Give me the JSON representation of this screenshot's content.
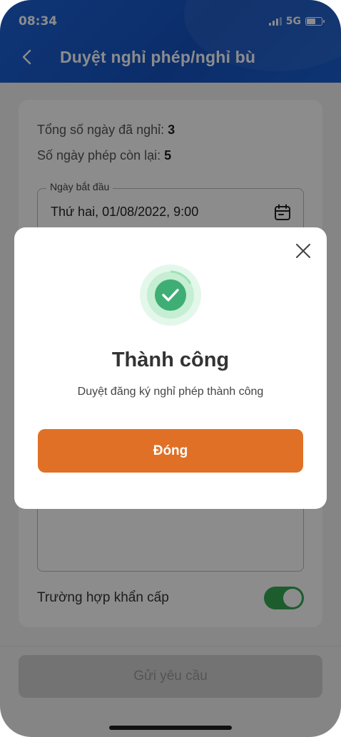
{
  "status_bar": {
    "time": "08:34",
    "network": "5G"
  },
  "header": {
    "title": "Duyệt nghỉ phép/nghỉ bù"
  },
  "form": {
    "total_days_label": "Tổng số ngày đã nghỉ: ",
    "total_days_value": "3",
    "remaining_days_label": "Số ngày phép còn lại: ",
    "remaining_days_value": "5",
    "start_date_label": "Ngày bắt đầu",
    "start_date_value": "Thứ hai, 01/08/2022, 9:00",
    "emergency_label": "Trường hợp khẩn cấp",
    "emergency_enabled": true
  },
  "submit_label": "Gửi yêu cầu",
  "modal": {
    "title": "Thành công",
    "message": "Duyệt đăng ký nghỉ phép thành công",
    "close_label": "Đóng"
  },
  "colors": {
    "header": "#1553c2",
    "accent": "#e07026",
    "success": "#34a853",
    "toggle": "#34a853"
  },
  "icons": [
    "back-icon",
    "calendar-icon",
    "close-icon",
    "check-icon",
    "signal-icon",
    "battery-icon"
  ]
}
